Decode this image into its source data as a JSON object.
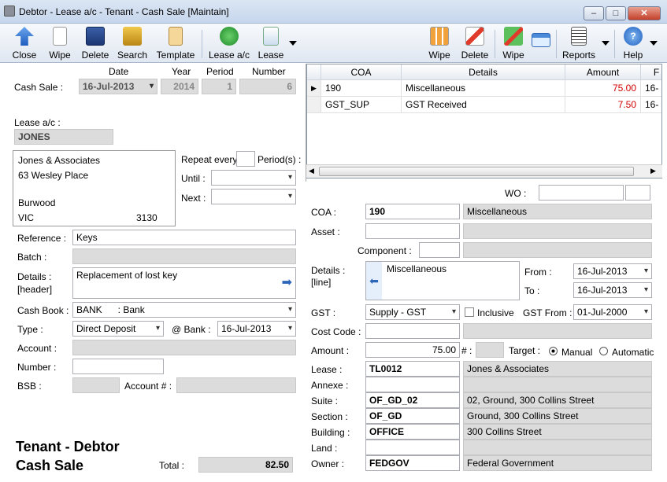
{
  "window": {
    "title": "Debtor - Lease a/c - Tenant - Cash Sale [Maintain]"
  },
  "toolbar": {
    "close": "Close",
    "wipe": "Wipe",
    "delete": "Delete",
    "search": "Search",
    "template": "Template",
    "lease_ac": "Lease a/c",
    "lease": "Lease",
    "wipe2": "Wipe",
    "delete2": "Delete",
    "wipe3": "Wipe",
    "reports": "Reports",
    "help": "Help"
  },
  "header": {
    "cash_sale_label": "Cash Sale :",
    "date_label": "Date",
    "year_label": "Year",
    "period_label": "Period",
    "number_label": "Number",
    "date": "16-Jul-2013",
    "year": "2014",
    "period": "1",
    "number": "6"
  },
  "lease_ac": {
    "label": "Lease a/c :",
    "value": "JONES"
  },
  "address": {
    "line1": "Jones & Associates",
    "line2": "63 Wesley Place",
    "line3": "",
    "line4": "Burwood",
    "state": "VIC",
    "postcode": "3130"
  },
  "repeat": {
    "repeat_label": "Repeat every",
    "periods_label": "Period(s) :",
    "until_label": "Until :",
    "next_label": "Next :"
  },
  "left": {
    "reference_label": "Reference :",
    "reference": "Keys",
    "batch_label": "Batch :",
    "details_label1": "Details :",
    "details_label2": "[header]",
    "details": "Replacement of lost key",
    "cashbook_label": "Cash Book :",
    "cashbook": "BANK      : Bank",
    "type_label": "Type :",
    "type": "Direct Deposit",
    "atbank_label": "@ Bank :",
    "atbank": "16-Jul-2013",
    "account_label": "Account :",
    "number_label": "Number :",
    "bsb_label": "BSB :",
    "accountno_label": "Account # :",
    "total_label": "Total :",
    "total": "82.50",
    "footer1": "Tenant - Debtor",
    "footer2": "Cash Sale"
  },
  "grid": {
    "headers": [
      "COA",
      "Details",
      "Amount",
      "F"
    ],
    "rows": [
      {
        "coa": "190",
        "details": "Miscellaneous",
        "amount": "75.00",
        "f": "16-"
      },
      {
        "coa": "GST_SUP",
        "details": "GST Received",
        "amount": "7.50",
        "f": "16-"
      }
    ]
  },
  "right": {
    "wo_label": "WO :",
    "coa_label": "COA :",
    "coa": "190",
    "coa_desc": "Miscellaneous",
    "asset_label": "Asset :",
    "component_label": "Component :",
    "details_label1": "Details :",
    "details_label2": "[line]",
    "details": "Miscellaneous",
    "from_label": "From :",
    "from": "16-Jul-2013",
    "to_label": "To :",
    "to": "16-Jul-2013",
    "gst_label": "GST :",
    "gst": "Supply - GST",
    "inclusive_label": "Inclusive",
    "gstfrom_label": "GST From :",
    "gstfrom": "01-Jul-2000",
    "costcode_label": "Cost Code :",
    "amount_label": "Amount :",
    "amount": "75.00",
    "hash_label": "# :",
    "target_label": "Target :",
    "manual_label": "Manual",
    "automatic_label": "Automatic",
    "lease_label": "Lease :",
    "lease": "TL0012",
    "lease_desc": "Jones & Associates",
    "annexe_label": "Annexe :",
    "suite_label": "Suite :",
    "suite": "OF_GD_02",
    "suite_desc": "02, Ground, 300 Collins Street",
    "section_label": "Section :",
    "section": "OF_GD",
    "section_desc": "Ground, 300 Collins Street",
    "building_label": "Building :",
    "building": "OFFICE",
    "building_desc": "300 Collins Street",
    "land_label": "Land :",
    "owner_label": "Owner :",
    "owner": "FEDGOV",
    "owner_desc": "Federal Government"
  },
  "colors": {
    "accent": "#2d66b8",
    "negative_red": "#d00000"
  }
}
